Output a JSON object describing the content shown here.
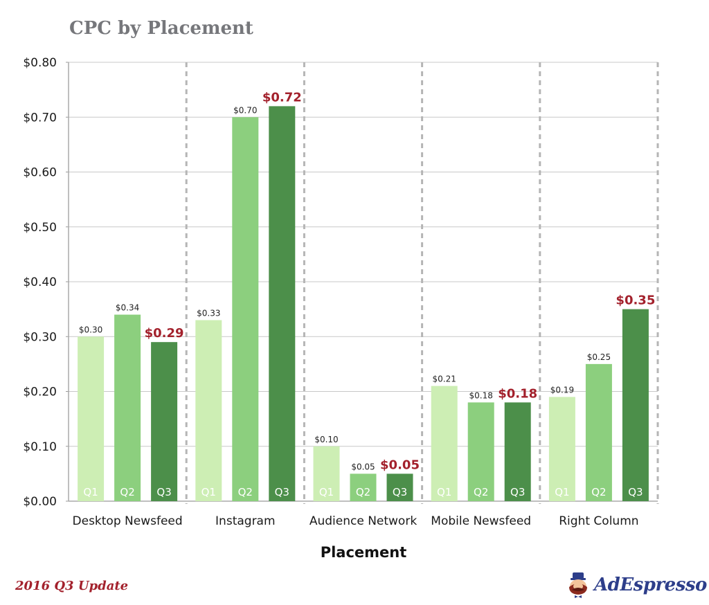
{
  "chart_data": {
    "type": "bar",
    "title": "CPC by Placement",
    "xlabel": "Placement",
    "ylabel": "",
    "ylim": [
      0,
      0.8
    ],
    "yticks": [
      0.0,
      0.1,
      0.2,
      0.3,
      0.4,
      0.5,
      0.6,
      0.7,
      0.8
    ],
    "ytick_labels": [
      "$0.00",
      "$0.10",
      "$0.20",
      "$0.30",
      "$0.40",
      "$0.50",
      "$0.60",
      "$0.70",
      "$0.80"
    ],
    "grid": true,
    "categories": [
      "Desktop Newsfeed",
      "Instagram",
      "Audience Network",
      "Mobile Newsfeed",
      "Right Column"
    ],
    "series": [
      {
        "name": "Q1",
        "color": "#cdeeb4",
        "values": [
          0.3,
          0.33,
          0.1,
          0.21,
          0.19
        ],
        "labels": [
          "$0.30",
          "$0.33",
          "$0.10",
          "$0.21",
          "$0.19"
        ]
      },
      {
        "name": "Q2",
        "color": "#8ccf7e",
        "values": [
          0.34,
          0.7,
          0.05,
          0.18,
          0.25
        ],
        "labels": [
          "$0.34",
          "$0.70",
          "$0.05",
          "$0.18",
          "$0.25"
        ]
      },
      {
        "name": "Q3",
        "color": "#4c8f4a",
        "values": [
          0.29,
          0.72,
          0.05,
          0.18,
          0.35
        ],
        "labels": [
          "$0.29",
          "$0.72",
          "$0.05",
          "$0.18",
          "$0.35"
        ],
        "highlight": true
      }
    ],
    "highlight_color": "#a3212c"
  },
  "footer": {
    "note": "2016 Q3 Update",
    "brand": "AdEspresso"
  }
}
